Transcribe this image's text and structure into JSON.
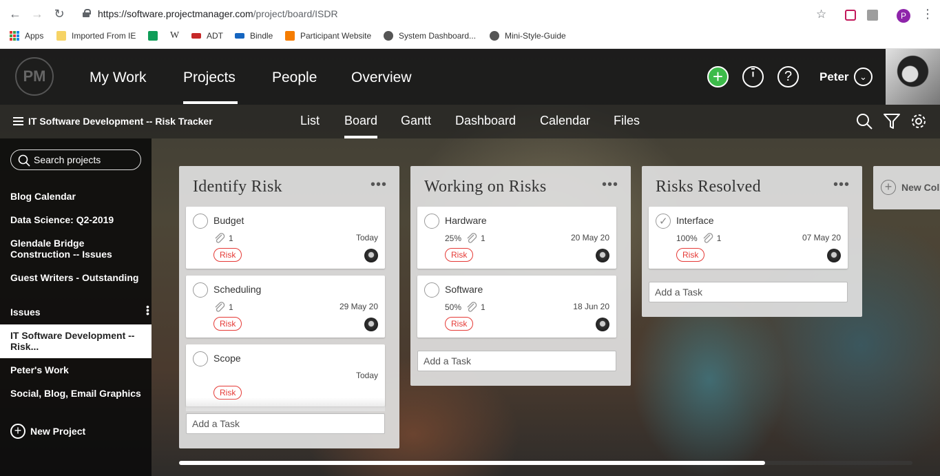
{
  "browser": {
    "url_main": "https://software.projectmanager.com",
    "url_path": "/project/board/ISDR",
    "profile_initial": "P",
    "bookmarks": [
      {
        "label": "Apps"
      },
      {
        "label": "Imported From IE"
      },
      {
        "label": ""
      },
      {
        "label": "W"
      },
      {
        "label": "ADT"
      },
      {
        "label": "Bindle"
      },
      {
        "label": "Participant Website"
      },
      {
        "label": "System Dashboard..."
      },
      {
        "label": "Mini-Style-Guide"
      }
    ]
  },
  "topnav": {
    "logo": "PM",
    "links": [
      "My Work",
      "Projects",
      "People",
      "Overview"
    ],
    "active": "Projects",
    "user_name": "Peter",
    "accent": "#3dbb4a"
  },
  "subnav": {
    "project_title": "IT Software Development -- Risk Tracker",
    "tabs": [
      "List",
      "Board",
      "Gantt",
      "Dashboard",
      "Calendar",
      "Files"
    ],
    "active_tab": "Board"
  },
  "sidebar": {
    "search_placeholder": "Search projects",
    "items": [
      "Blog Calendar",
      "Data Science: Q2-2019",
      "Glendale Bridge Construction -- Issues",
      "Guest Writers - Outstanding",
      "Issues",
      "IT Software Development -- Risk...",
      "Peter's Work",
      "Social, Blog, Email Graphics"
    ],
    "active_item": "IT Software Development -- Risk...",
    "new_project": "New Project"
  },
  "board": {
    "add_task_label": "Add a Task",
    "new_column_label": "New Column",
    "columns": [
      {
        "title": "Identify Risk",
        "cards": [
          {
            "name": "Budget",
            "progress": "",
            "attachments": "1",
            "due": "Today",
            "tag": "Risk",
            "done": false
          },
          {
            "name": "Scheduling",
            "progress": "",
            "attachments": "1",
            "due": "29 May 20",
            "tag": "Risk",
            "done": false
          },
          {
            "name": "Scope",
            "progress": "",
            "attachments": "",
            "due": "Today",
            "tag": "Risk",
            "done": false
          }
        ]
      },
      {
        "title": "Working on Risks",
        "cards": [
          {
            "name": "Hardware",
            "progress": "25%",
            "attachments": "1",
            "due": "20 May 20",
            "tag": "Risk",
            "done": false
          },
          {
            "name": "Software",
            "progress": "50%",
            "attachments": "1",
            "due": "18 Jun 20",
            "tag": "Risk",
            "done": false
          }
        ]
      },
      {
        "title": "Risks Resolved",
        "cards": [
          {
            "name": "Interface",
            "progress": "100%",
            "attachments": "1",
            "due": "07 May 20",
            "tag": "Risk",
            "done": true
          }
        ]
      }
    ],
    "horizontal_scroll_position": 0.8
  }
}
